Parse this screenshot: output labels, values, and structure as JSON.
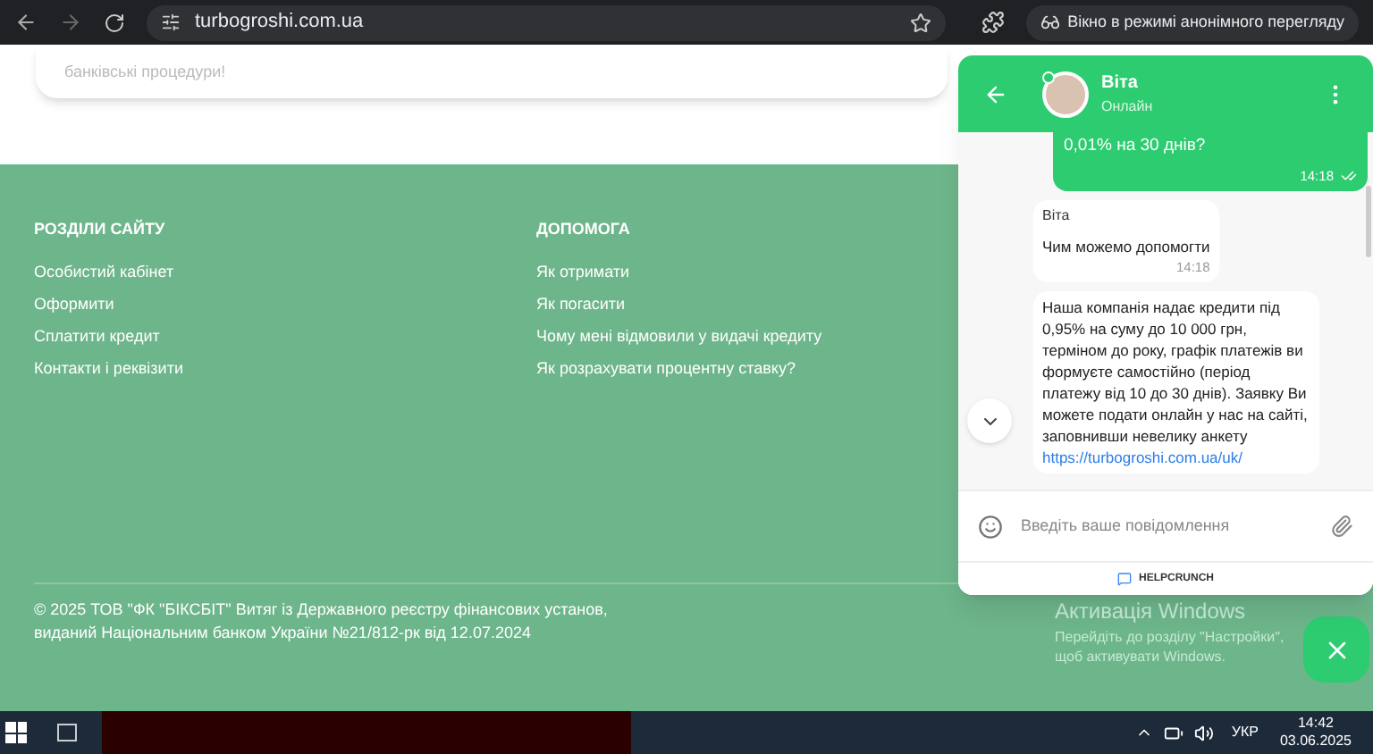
{
  "browser": {
    "url": "turbogroshi.com.ua",
    "incognito_label": "Вікно в режимі анонімного перегляду"
  },
  "page": {
    "card_text": "банківські процедури!",
    "footer": {
      "columns": [
        {
          "title": "РОЗДІЛИ САЙТУ",
          "links": [
            "Особистий кабінет",
            "Оформити",
            "Сплатити кредит",
            "Контакти і реквізити"
          ]
        },
        {
          "title": "ДОПОМОГА",
          "links": [
            "Як отримати",
            "Як погасити",
            "Чому мені відмовили у видачі кредиту",
            "Як розрахувати процентну ставку?"
          ]
        }
      ],
      "copyright": [
        "© 2025 ТОВ \"ФК \"БІКСБІТ\" Витяг із Державного реєстру фінансових установ,",
        "виданий Національним банком України №21/812-рк від 12.07.2024"
      ]
    }
  },
  "chat": {
    "agent": {
      "name": "Віта",
      "status": "Онлайн",
      "online": true
    },
    "messages": [
      {
        "kind": "outgoing",
        "text": "0,01% на 30 днів?",
        "time": "14:18",
        "read": true
      },
      {
        "kind": "incoming",
        "author": "Віта",
        "text": "Чим можемо допомогти",
        "time": "14:18"
      },
      {
        "kind": "incoming",
        "text": "Наша компанія надає кредити під 0,95% на суму до 10 000 грн, терміном до року, графік платежів ви формуєте самостійно (період платежу від 10 до 30 днів). Заявку Ви можете подати онлайн у нас на сайті, заповнивши невелику анкету",
        "link": "https://turbogroshi.com.ua/uk/"
      }
    ],
    "input_placeholder": "Введіть ваше повідомлення",
    "branding": "HELPCRUNCH"
  },
  "windows_activation": {
    "title": "Активація Windows",
    "text": "Перейдіть до розділу \"Настройки\", щоб активувати Windows."
  },
  "taskbar": {
    "language": "УКР",
    "time": "14:42",
    "date": "03.06.2025"
  }
}
